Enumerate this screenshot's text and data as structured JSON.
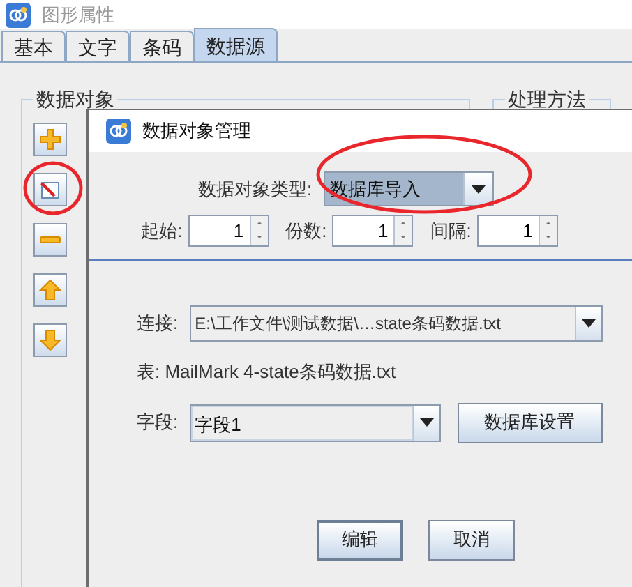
{
  "window": {
    "title": "图形属性"
  },
  "tabs": [
    {
      "label": "基本",
      "selected": false
    },
    {
      "label": "文字",
      "selected": false
    },
    {
      "label": "条码",
      "selected": false
    },
    {
      "label": "数据源",
      "selected": true
    }
  ],
  "groups": [
    {
      "title": "数据对象"
    },
    {
      "title": "处理方法"
    }
  ],
  "toolbar": [
    {
      "kind": "add"
    },
    {
      "kind": "edit"
    },
    {
      "kind": "remove"
    },
    {
      "kind": "up"
    },
    {
      "kind": "down"
    }
  ],
  "dialog": {
    "title": "数据对象管理",
    "type_label": "数据对象类型:",
    "type_value": "数据库导入",
    "spinners": [
      {
        "label": "起始:",
        "value": "1"
      },
      {
        "label": "份数:",
        "value": "1"
      },
      {
        "label": "间隔:",
        "value": "1"
      }
    ],
    "connection": {
      "label": "连接:",
      "value": "E:\\工作文件\\测试数据\\…state条码数据.txt"
    },
    "table_text": "表: MailMark 4-state条码数据.txt",
    "field": {
      "label": "字段:",
      "value": "字段1"
    },
    "db_settings_button": "数据库设置",
    "buttons": [
      {
        "label": "编辑",
        "default": true
      },
      {
        "label": "取消",
        "default": false
      }
    ]
  }
}
